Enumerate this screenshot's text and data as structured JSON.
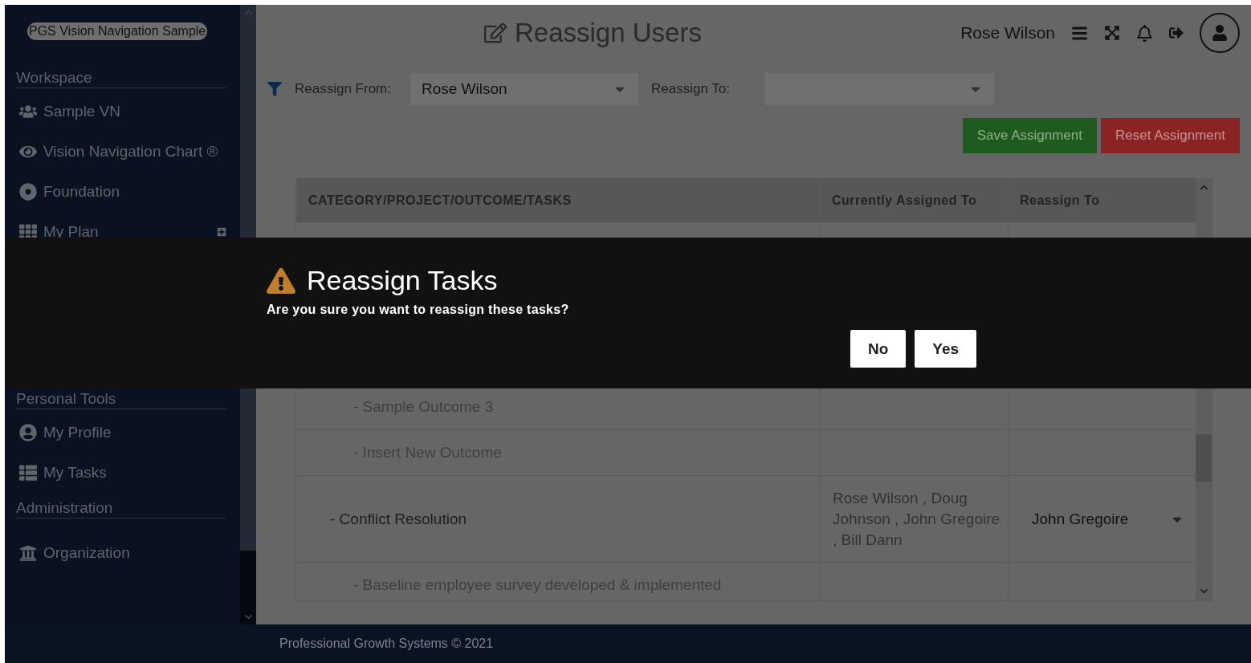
{
  "sidebar": {
    "logo": "PGS Vision Navigation Sample",
    "sections": [
      {
        "title": "Workspace",
        "items": [
          {
            "label": "Sample VN",
            "expandable": false
          },
          {
            "label": "Vision Navigation Chart ®",
            "expandable": false
          },
          {
            "label": "Foundation",
            "expandable": false
          },
          {
            "label": "My Plan",
            "expandable": true
          }
        ]
      },
      {
        "title": "Personal Tools",
        "items": [
          {
            "label": "My Profile",
            "expandable": false
          },
          {
            "label": "My Tasks",
            "expandable": false
          }
        ]
      },
      {
        "title": "Administration",
        "items": [
          {
            "label": "Organization",
            "expandable": false
          }
        ]
      }
    ]
  },
  "header": {
    "title": "Reassign Users",
    "user": "Rose Wilson"
  },
  "filters": {
    "from_label": "Reassign From:",
    "from_value": "Rose Wilson",
    "to_label": "Reassign To:"
  },
  "buttons": [
    {
      "label": "Save Assignment",
      "kind": "save"
    },
    {
      "label": "Reset Assignment",
      "kind": "reset"
    }
  ],
  "table": {
    "columns": [
      "CATEGORY/PROJECT/OUTCOME/TASKS",
      "Currently Assigned To",
      "Reassign To"
    ],
    "rows": [
      {
        "kind": "outcome"
      },
      {
        "kind": "outcome"
      },
      {
        "kind": "outcome"
      },
      {
        "kind": "outcome"
      },
      {
        "kind": "outcome",
        "task": "- Sample Outcome 3"
      },
      {
        "kind": "outcome",
        "task": "- Insert New Outcome"
      },
      {
        "kind": "project",
        "task": "- Conflict Resolution",
        "assigned": "Rose Wilson , Doug Johnson , John Gregoire , Bill Dann",
        "reassign": "John Gregoire"
      },
      {
        "kind": "outcome",
        "task": "- Baseline employee survey developed & implemented"
      }
    ]
  },
  "dialog": {
    "title": "Reassign Tasks",
    "message": "Are you sure you want to reassign these tasks?",
    "buttons": [
      "No",
      "Yes"
    ]
  },
  "footer": "Professional Growth Systems © 2021"
}
